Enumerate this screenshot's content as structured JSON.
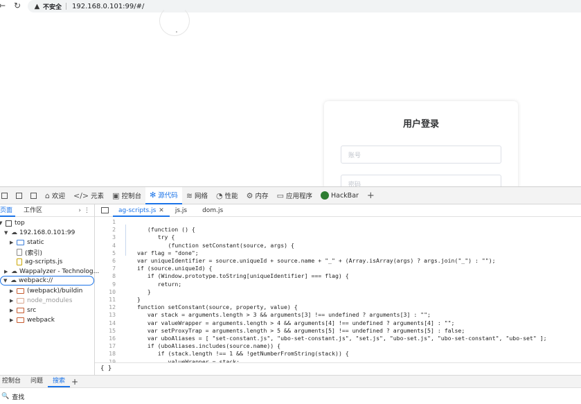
{
  "browser": {
    "insecure_label": "不安全",
    "url": "192.168.0.101:99/#/"
  },
  "login": {
    "title": "用户登录",
    "account_placeholder": "账号",
    "password_placeholder": "密码"
  },
  "devtools": {
    "tools": [
      {
        "name": "welcome",
        "label": "欢迎",
        "icon": "home-icon"
      },
      {
        "name": "elements",
        "label": "元素",
        "icon": "code-icon"
      },
      {
        "name": "console",
        "label": "控制台",
        "icon": "console-icon"
      },
      {
        "name": "sources",
        "label": "源代码",
        "icon": "bug-icon",
        "active": true
      },
      {
        "name": "network",
        "label": "网络",
        "icon": "wifi-icon"
      },
      {
        "name": "performance",
        "label": "性能",
        "icon": "gauge-icon"
      },
      {
        "name": "memory",
        "label": "内存",
        "icon": "gear-icon"
      },
      {
        "name": "application",
        "label": "应用程序",
        "icon": "app-icon"
      },
      {
        "name": "hackbar",
        "label": "HackBar",
        "icon": "hackbar-icon"
      }
    ],
    "navigator": {
      "tabs": [
        "页面",
        "工作区"
      ],
      "tree": [
        {
          "label": "top",
          "type": "frame",
          "arrow": "down",
          "indent": 0
        },
        {
          "label": "192.168.0.101:99",
          "type": "cloud",
          "arrow": "down",
          "indent": 1
        },
        {
          "label": "static",
          "type": "folder-blue",
          "arrow": "right",
          "indent": 2
        },
        {
          "label": "(索引)",
          "type": "file",
          "arrow": "",
          "indent": 2
        },
        {
          "label": "ag-scripts.js",
          "type": "file-yellow",
          "arrow": "",
          "indent": 2
        },
        {
          "label": "Wappalyzer - Technolog...",
          "type": "cloud",
          "arrow": "right",
          "indent": 1
        },
        {
          "label": "webpack://",
          "type": "cloud",
          "arrow": "down",
          "indent": 1,
          "selected": true
        },
        {
          "label": "(webpack)/buildin",
          "type": "folder",
          "arrow": "right",
          "indent": 2
        },
        {
          "label": "node_modules",
          "type": "folder-gray",
          "arrow": "right",
          "indent": 2,
          "dim": true
        },
        {
          "label": "src",
          "type": "folder",
          "arrow": "right",
          "indent": 2
        },
        {
          "label": "webpack",
          "type": "folder",
          "arrow": "right",
          "indent": 2
        }
      ]
    },
    "editor": {
      "tabs": [
        {
          "label": "ag-scripts.js",
          "active": true,
          "closable": true
        },
        {
          "label": "js.js"
        },
        {
          "label": "dom.js"
        }
      ],
      "lines": [
        {
          "n": "1",
          "indent": 0,
          "code": ""
        },
        {
          "n": "2",
          "indent": 2,
          "code": "(function () {"
        },
        {
          "n": "3",
          "indent": 4,
          "code": "try {"
        },
        {
          "n": "4",
          "indent": 6,
          "code": "(function setConstant(source, args) {"
        },
        {
          "n": "5",
          "indent": 0,
          "code": "var flag = \"done\";"
        },
        {
          "n": "6",
          "indent": 0,
          "code": "var uniqueIdentifier = source.uniqueId + source.name + \"_\" + (Array.isArray(args) ? args.join(\"_\") : \"\");"
        },
        {
          "n": "7",
          "indent": 0,
          "code": "if (source.uniqueId) {"
        },
        {
          "n": "8",
          "indent": 2,
          "code": "if (Window.prototype.toString[uniqueIdentifier] === flag) {"
        },
        {
          "n": "9",
          "indent": 4,
          "code": "return;"
        },
        {
          "n": "10",
          "indent": 2,
          "code": "}"
        },
        {
          "n": "11",
          "indent": 0,
          "code": "}"
        },
        {
          "n": "12",
          "indent": 0,
          "code": "function setConstant(source, property, value) {"
        },
        {
          "n": "13",
          "indent": 2,
          "code": "var stack = arguments.length > 3 && arguments[3] !== undefined ? arguments[3] : \"\";"
        },
        {
          "n": "14",
          "indent": 2,
          "code": "var valueWrapper = arguments.length > 4 && arguments[4] !== undefined ? arguments[4] : \"\";"
        },
        {
          "n": "15",
          "indent": 2,
          "code": "var setProxyTrap = arguments.length > 5 && arguments[5] !== undefined ? arguments[5] : false;"
        },
        {
          "n": "16",
          "indent": 2,
          "code": "var uboAliases = [ \"set-constant.js\", \"ubo-set-constant.js\", \"set.js\", \"ubo-set.js\", \"ubo-set-constant\", \"ubo-set\" ];"
        },
        {
          "n": "17",
          "indent": 2,
          "code": "if (uboAliases.includes(source.name)) {"
        },
        {
          "n": "18",
          "indent": 4,
          "code": "if (stack.length !== 1 && !getNumberFromString(stack)) {"
        },
        {
          "n": "19",
          "indent": 6,
          "code": "valueWrapper = stack;"
        }
      ],
      "status": "{ }"
    },
    "drawer": {
      "tabs": [
        "控制台",
        "问题",
        "搜索"
      ],
      "active_tab": "搜索",
      "search_label": "查找"
    }
  }
}
